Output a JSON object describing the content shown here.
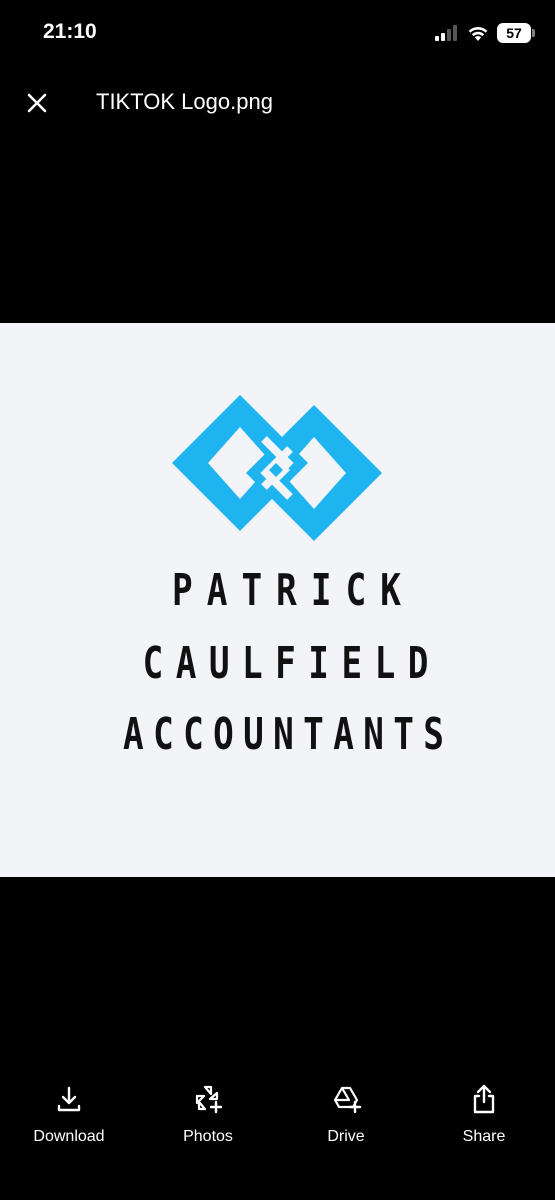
{
  "status_bar": {
    "time": "21:10",
    "battery": "57"
  },
  "header": {
    "title": "TIKTOK Logo.png",
    "close_icon": "close-icon"
  },
  "image": {
    "logo_lines": [
      "PATRICK",
      "CAULFIELD",
      "ACCOUNTANTS"
    ],
    "logo_color": "#1eb4f0",
    "background": "#f3f4f8"
  },
  "actions": [
    {
      "label": "Download",
      "icon": "download-icon"
    },
    {
      "label": "Photos",
      "icon": "photos-add-icon"
    },
    {
      "label": "Drive",
      "icon": "drive-add-icon"
    },
    {
      "label": "Share",
      "icon": "share-icon"
    }
  ]
}
